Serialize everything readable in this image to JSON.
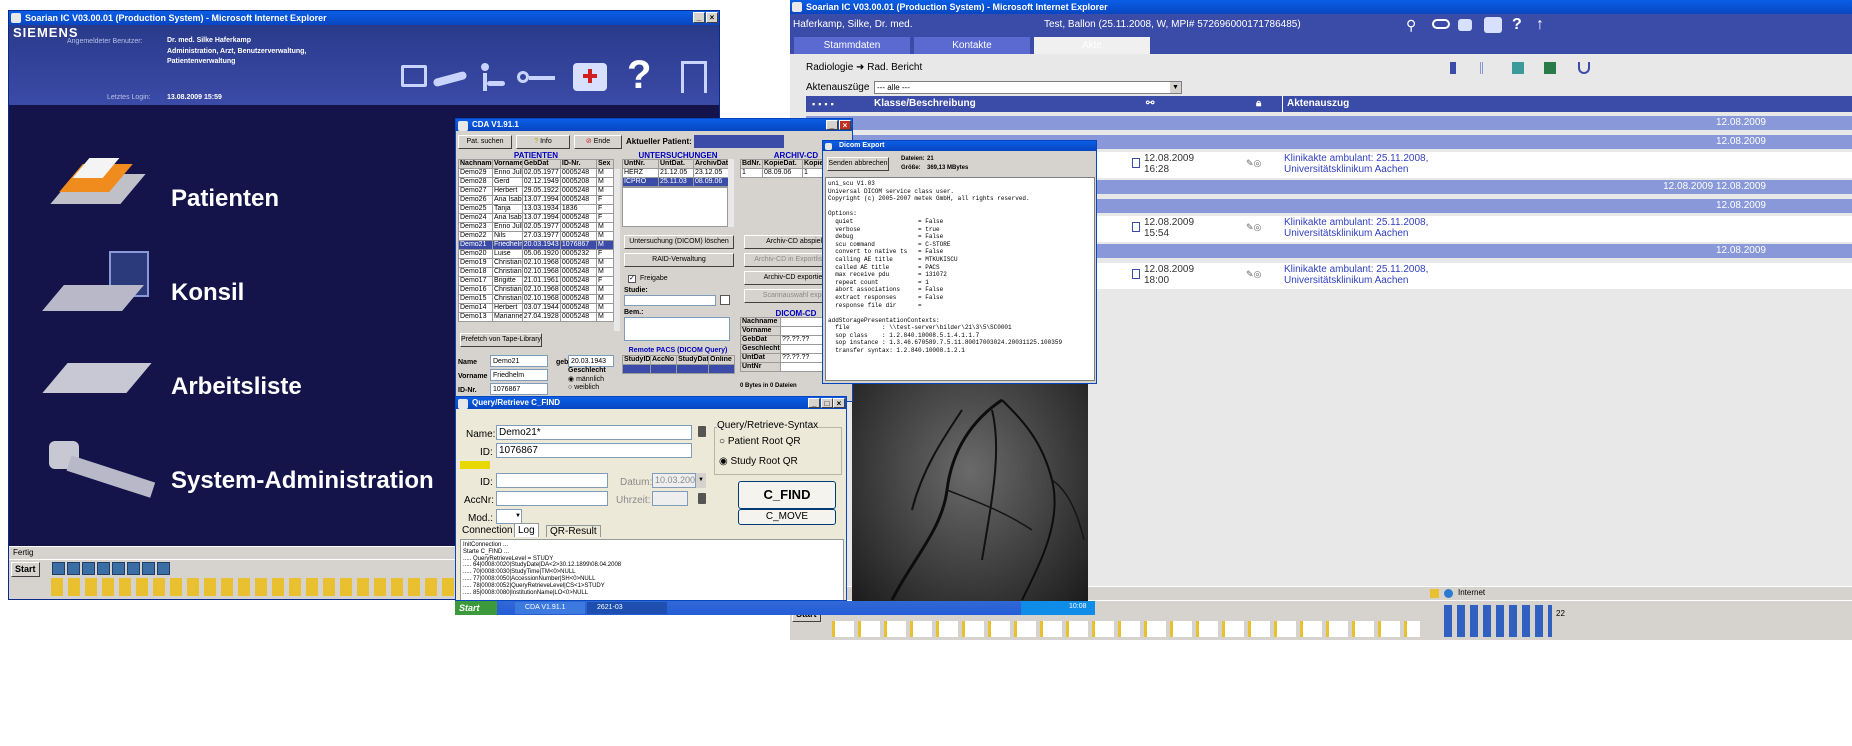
{
  "win1": {
    "title": "Soarian IC V03.00.01 (Production System) - Microsoft Internet Explorer",
    "brand": "SIEMENS",
    "user_label": "Angemeldeter Benutzer:",
    "user_name": "Dr. med. Silke Haferkamp",
    "user_roles": "Administration, Arzt, Benutzerverwaltung, Patientenverwaltung",
    "login_label": "Letztes Login:",
    "login_value": "13.08.2009 15:59",
    "menu": [
      "Patienten",
      "Konsil",
      "Arbeitsliste",
      "System-Administration"
    ],
    "status": "Fertig",
    "start": "Start"
  },
  "win2": {
    "title": "Soarian IC V03.00.01 (Production System) - Microsoft Internet Explorer",
    "doctor": "Haferkamp, Silke, Dr. med.",
    "patient": "Test, Ballon (25.11.2008, W, MPI# 572696000171786485)",
    "tabs": [
      "Stammdaten",
      "Kontakte",
      "Akte"
    ],
    "breadcrumb_a": "Radiologie",
    "breadcrumb_b": "Rad. Bericht",
    "filter_label": "Aktenauszüge",
    "filter_value": "--- alle ---",
    "col_class": "Klasse/Beschreibung",
    "col_extract": "Aktenauszug",
    "date_bars": [
      "12.08.2009",
      "12.08.2009",
      "12.08.2009 12.08.2009",
      "12.08.2009",
      "12.08.2009"
    ],
    "entries": [
      {
        "date": "12.08.2009",
        "time": "16:28",
        "link": "Klinikakte ambulant: 25.11.2008, Universitätsklinikum Aachen"
      },
      {
        "date": "12.08.2009",
        "time": "15:54",
        "link": "Klinikakte ambulant: 25.11.2008, Universitätsklinikum Aachen"
      },
      {
        "date": "12.08.2009",
        "time": "18:00",
        "link": "Klinikakte ambulant: 25.11.2008, Universitätsklinikum Aachen"
      }
    ],
    "status_zone": "Internet",
    "start": "Start",
    "clock": "22"
  },
  "cda": {
    "title": "CDA V1.91.1",
    "btn_search": "Pat. suchen",
    "btn_info": "Info",
    "btn_end": "Ende",
    "current_patient_label": "Aktueller Patient:",
    "patients_head": "PATIENTEN",
    "patient_cols": [
      "Nachname",
      "Vorname",
      "GebDat",
      "ID-Nr.",
      "Sex"
    ],
    "patients": [
      [
        "Demo29",
        "Enno Julha",
        "02.05.1977",
        "0005248",
        "M"
      ],
      [
        "Demo28",
        "Gerd",
        "02.12.1949",
        "0005208",
        "M"
      ],
      [
        "Demo27",
        "Herbert",
        "29.05.1922",
        "0005248",
        "M"
      ],
      [
        "Demo26",
        "Ana Isabe",
        "13.07.1994",
        "0005248",
        "F"
      ],
      [
        "Demo25",
        "Tanja",
        "13.03.1934",
        "1836",
        "F"
      ],
      [
        "Demo24",
        "Ana Isabe",
        "13.07.1994",
        "0005248",
        "F"
      ],
      [
        "Demo23",
        "Enno Julha",
        "02.05.1977",
        "0005248",
        "M"
      ],
      [
        "Demo22",
        "Nils",
        "27.03.1977",
        "0005248",
        "M"
      ],
      [
        "Demo21",
        "Friedhelm",
        "20.03.1943",
        "1076867",
        "M"
      ],
      [
        "Demo20",
        "Luise",
        "05.06.1920",
        "0005232",
        "F"
      ],
      [
        "Demo19",
        "Christian-1",
        "02.10.1968",
        "0005248",
        "M"
      ],
      [
        "Demo18",
        "Christian-1",
        "02.10.1968",
        "0005248",
        "M"
      ],
      [
        "Demo17",
        "Brigitte",
        "21.01.1961",
        "0005248",
        "F"
      ],
      [
        "Demo16",
        "Christian-1",
        "02.10.1968",
        "0005248",
        "M"
      ],
      [
        "Demo15",
        "Christian-1",
        "02.10.1968",
        "0005248",
        "M"
      ],
      [
        "Demo14",
        "Herbert",
        "03.07.1944",
        "0005248",
        "M"
      ],
      [
        "Demo13",
        "Marianne",
        "27.04.1928",
        "0005248",
        "M"
      ]
    ],
    "studies_head": "UNTERSUCHUNGEN (DICOM)",
    "study_cols": [
      "UntNr.",
      "UntDat.",
      "ArchivDat."
    ],
    "studies": [
      [
        "HERZ",
        "21.12.05",
        "23.12.05"
      ],
      [
        "ICPRO",
        "25.11.03",
        "08.09.06"
      ]
    ],
    "archive_head": "ARCHIV-CD",
    "archive_cols": [
      "BdNr.",
      "KopieDat.",
      "Kopien"
    ],
    "archive_rows": [
      [
        "1",
        "08.09.06",
        "1"
      ]
    ],
    "btn_prefetch": "Prefetch von Tape-Library",
    "btn_delete_study": "Untersuchung (DICOM) löschen",
    "btn_raid": "RAID-Verwaltung",
    "btn_play_cd": "Archiv-CD abspielen",
    "btn_export_list": "Archiv-CD in Exportliste auf.",
    "btn_export_cd": "Archiv-CD exportieren",
    "btn_scan": "Scannauswahl exporti.",
    "release_label": "Freigabe",
    "study_label": "Studie:",
    "note_label": "Bem.:",
    "name_label": "Name",
    "name_value": "Demo21",
    "birth_label": "geb.",
    "birth_value": "20.03.1943",
    "firstname_label": "Vorname",
    "firstname_value": "Friedhelm",
    "sex_label": "Geschlecht",
    "sex_m": "männlich",
    "sex_f": "weiblich",
    "id_label": "ID-Nr.",
    "id_value": "1076867",
    "remote_head": "Remote PACS (DICOM Query)",
    "remote_cols": [
      "StudyID",
      "AccNo",
      "StudyDate",
      "Online"
    ],
    "dicomcd_head": "DICOM-CD",
    "dicomcd_rows": [
      [
        "Nachname",
        ""
      ],
      [
        "Vorname",
        ""
      ],
      [
        "GebDat",
        "??.??.??"
      ],
      [
        "Geschlecht",
        ""
      ],
      [
        "UntDat",
        "??.??.??"
      ],
      [
        "UntNr",
        ""
      ]
    ],
    "bytes_label": "0 Bytes in 0 Dateien",
    "start": "Start",
    "task_cda": "CDA V1.91.1",
    "task_other": "2621-03",
    "clock": "10:08"
  },
  "dicom": {
    "title": "Dicom Export",
    "btn_send": "Senden abbrechen",
    "files_label": "Dateien:",
    "files_value": "21",
    "size_label": "Größe:",
    "size_value": "369,13 MBytes",
    "log": [
      "uni_scu V1.03",
      "Universal DICOM service class user.",
      "Copyright (c) 2005-2007 metek GmbH, all rights reserved.",
      "",
      "Options:",
      "  quiet                  = False",
      "  verbose                = true",
      "  debug                  = False",
      "  scu command            = C-STORE",
      "  convert to native ts   = False",
      "  calling AE title       = MTKUKISCU",
      "  called AE title        = PACS",
      "  max receive pdu        = 131072",
      "  repeat count           = 1",
      "  abort associations     = False",
      "  extract responses      = False",
      "  response file dir      =",
      "",
      "addStoragePresentationContexts:",
      "  file         : \\\\test-server\\bilder\\21\\3\\5\\SC0001",
      "  sop class    : 1.2.840.10008.5.1.4.1.1.7",
      "  sop instance : 1.3.46.670589.7.5.11.80017003024.20031125.100359",
      "  transfer syntax: 1.2.840.10008.1.2.1"
    ]
  },
  "query": {
    "title": "Query/Retrieve C_FIND",
    "name_label": "Name:",
    "name_value": "Demo21*",
    "id_label": "ID:",
    "id_value": "1076867",
    "id2_label": "ID:",
    "datum_label": "Datum:",
    "datum_value": "10.03.2007",
    "accnr_label": "AccNr:",
    "uhrzeit_label": "Uhrzeit:",
    "mod_label": "Mod.:",
    "syntax_label": "Query/Retrieve-Syntax",
    "radio_patient": "Patient Root QR",
    "radio_study": "Study Root QR",
    "btn_cfind": "C_FIND",
    "btn_cmove": "C_MOVE",
    "tabs": [
      "Connection",
      "Log",
      "QR-Result"
    ],
    "log": [
      "InitConnection ...",
      "Starte C_FIND ...",
      "..... QueryRetrieveLevel = STUDY",
      "..... 64|0008:0020|StudyDate|DA<2>30.12.1899\\08.04.2008",
      "..... 70|0008:0030|StudyTime|TM<0>NULL",
      "..... 77|0008:0050|AccessionNumber|SH<0>NULL",
      "..... 78|0008:0052|QueryRetrieveLevel|CS<1>STUDY",
      "..... 85|0008:0080|InstitutionName|LO<0>NULL"
    ]
  }
}
